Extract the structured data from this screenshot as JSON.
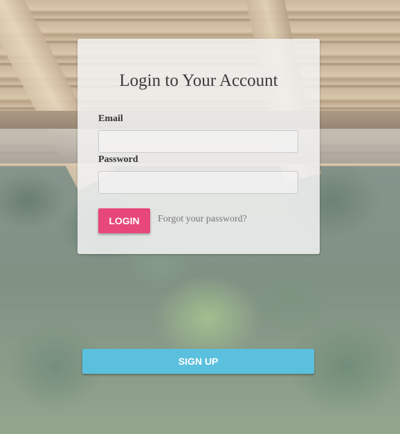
{
  "login_card": {
    "title": "Login to Your Account",
    "email_label": "Email",
    "email_value": "",
    "password_label": "Password",
    "password_value": "",
    "login_button_label": "LOGIN",
    "forgot_link_label": "Forgot your password?"
  },
  "signup": {
    "button_label": "SIGN UP"
  },
  "colors": {
    "login_button": "#e8477a",
    "signup_button": "#5bc0de",
    "card_background": "#f2f2f2",
    "title_text": "#3a3a3a",
    "link_text": "#777777"
  }
}
